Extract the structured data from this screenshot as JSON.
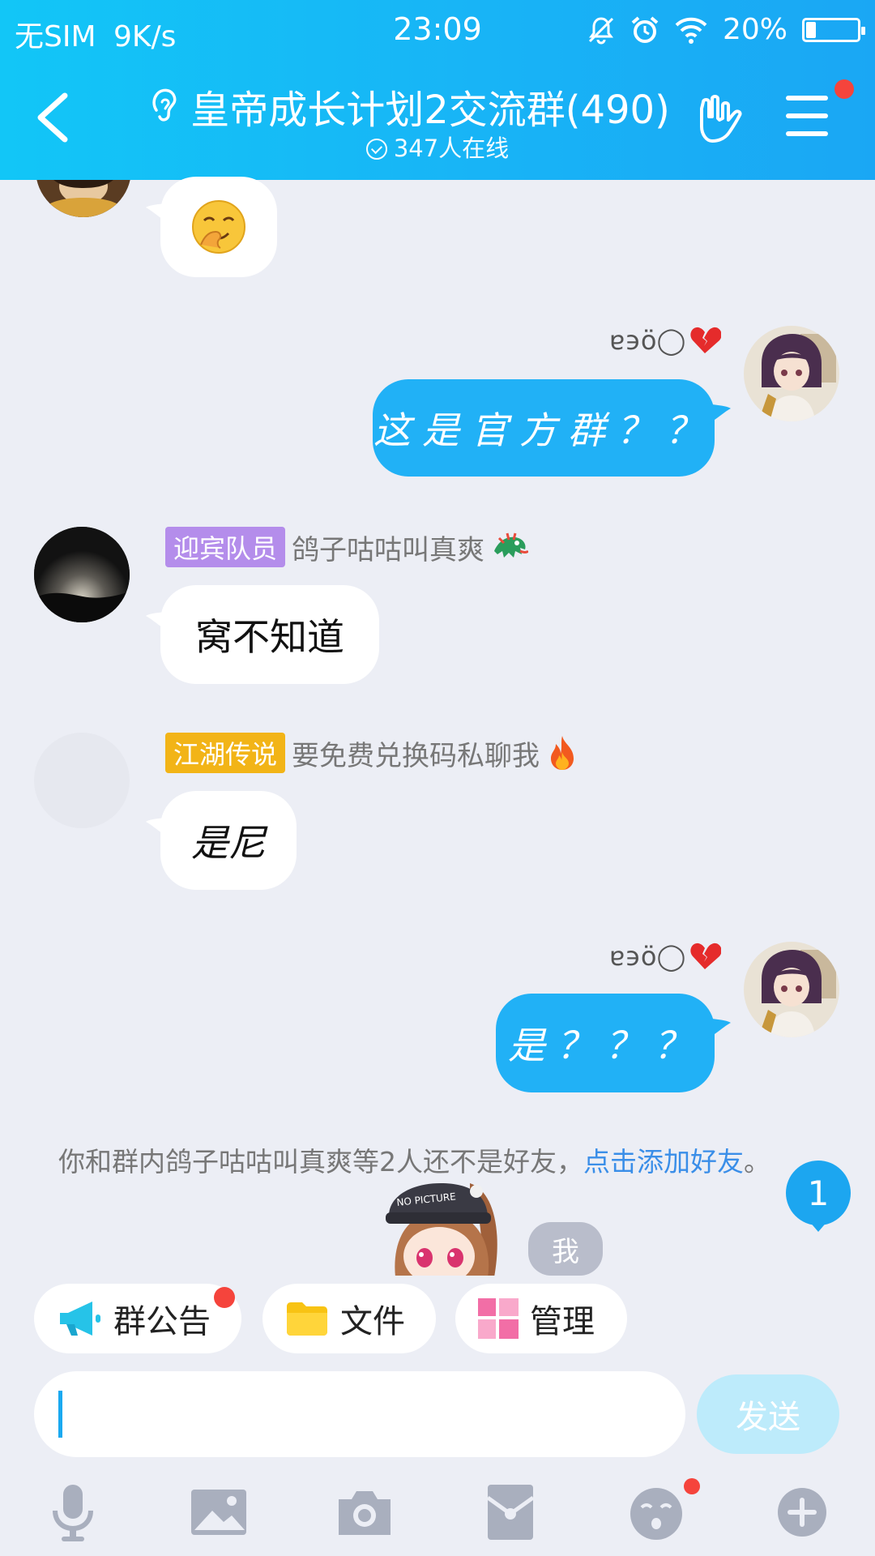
{
  "status_bar": {
    "carrier": "无SIM",
    "speed": "9K/s",
    "time": "23:09",
    "battery_percent": "20%",
    "battery_level": 0.2
  },
  "header": {
    "title": "皇帝成长计划2交流群(490)",
    "online": "347人在线"
  },
  "messages": [
    {
      "side": "left",
      "content_icon": "mouth-covered-smile-emoji"
    },
    {
      "side": "right",
      "sender": "ɐ϶ö◯",
      "sender_icon": "broken-heart-emoji",
      "text": "这是官方群？？"
    },
    {
      "side": "left",
      "badge": "迎宾队员",
      "badge_color": "#B48DEB",
      "sender": "鸽子咕咕叫真爽",
      "sender_icon": "dragon-emoji",
      "text": "窝不知道"
    },
    {
      "side": "left",
      "badge": "江湖传说",
      "badge_color": "#F2B417",
      "sender": "要免费兑换码私聊我",
      "sender_icon": "fire-emoji",
      "text": "是尼"
    },
    {
      "side": "right",
      "sender": "ɐ϶ö◯",
      "sender_icon": "broken-heart-emoji",
      "text": "是？？？"
    }
  ],
  "notice": {
    "text": "你和群内鸽子咕咕叫真爽等2人还不是好友，",
    "link": "点击添加好友",
    "suffix": "。"
  },
  "unread_count": "1",
  "me_tag": "我",
  "sticker_cap_text": "NO PICTURE",
  "quick_actions": [
    {
      "label": "群公告",
      "icon": "megaphone-icon"
    },
    {
      "label": "文件",
      "icon": "folder-icon"
    },
    {
      "label": "管理",
      "icon": "grid-icon"
    }
  ],
  "input": {
    "value": "",
    "send_label": "发送"
  },
  "toolbar": [
    "microphone-icon",
    "image-icon",
    "camera-icon",
    "red-envelope-icon",
    "emoji-icon",
    "plus-icon"
  ],
  "colors": {
    "header": "#18B4F6",
    "outgoing_bubble": "#21B1F6",
    "badge_purple": "#B48DEB",
    "badge_gold": "#F2B417",
    "link": "#3A8EE8",
    "notification_dot": "#F5443C"
  }
}
